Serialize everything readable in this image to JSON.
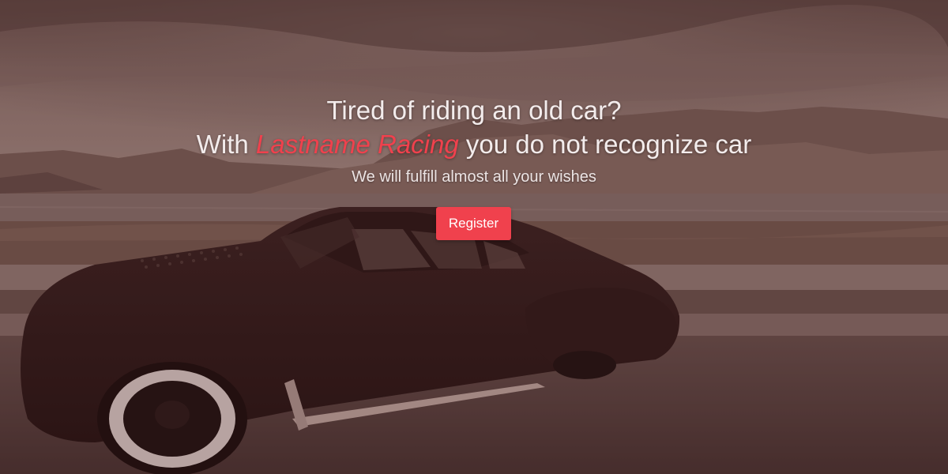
{
  "hero": {
    "headline_line1": "Tired of riding an old car?",
    "headline_line2_prefix": "With ",
    "headline_brand": "Lastname Racing",
    "headline_line2_suffix": " you do not recognize car",
    "subtitle": "We will fulfill almost all your wishes",
    "register_label": "Register",
    "background_image": "vintage-car-on-lakeside-road"
  },
  "colors": {
    "accent": "#f0414d",
    "text": "#f3ecec",
    "tint": "#5a2e2a"
  }
}
